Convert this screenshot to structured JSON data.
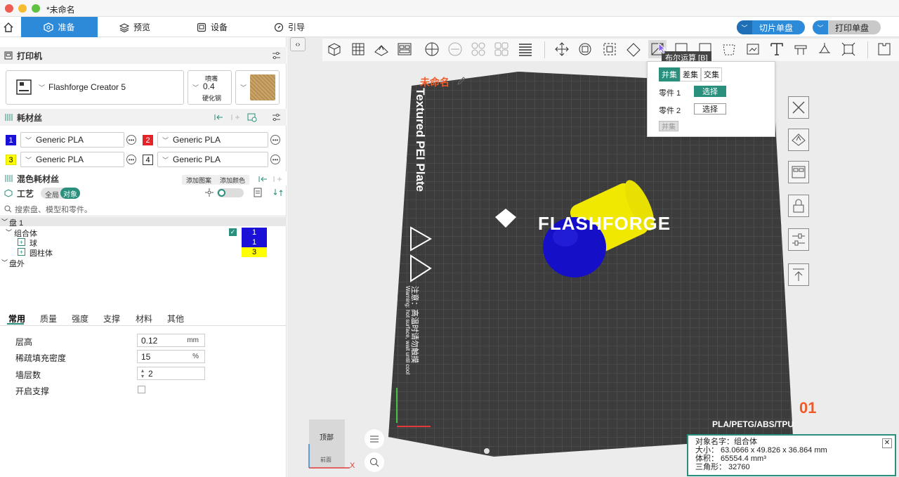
{
  "window": {
    "title": "*未命名"
  },
  "nav": {
    "home_label": "",
    "tabs": [
      {
        "label": "准备"
      },
      {
        "label": "预览"
      },
      {
        "label": "设备"
      },
      {
        "label": "引导"
      }
    ],
    "slice_button": "切片单盘",
    "print_button": "打印单盘"
  },
  "printer": {
    "section_title": "打印机",
    "name": "Flashforge Creator 5",
    "nozzle_label": "喷嘴",
    "nozzle_value": "0.4",
    "nozzle_type": "硬化钢"
  },
  "filament": {
    "section_title": "耗材丝",
    "slots": [
      {
        "num": "1",
        "name": "Generic PLA",
        "color": "#1a10d8"
      },
      {
        "num": "2",
        "name": "Generic PLA",
        "color": "#e5242a"
      },
      {
        "num": "3",
        "name": "Generic PLA",
        "color": "#ffff00"
      },
      {
        "num": "4",
        "name": "Generic PLA",
        "color": "#ffffff"
      }
    ]
  },
  "mixed": {
    "section_title": "混色耗材丝",
    "add_pattern": "添加图案",
    "add_color": "添加颜色"
  },
  "process": {
    "section_title": "工艺",
    "global_label": "全局",
    "object_label": "对象"
  },
  "search": {
    "placeholder": "搜索盘、模型和零件。"
  },
  "tree": {
    "plate": "盘 1",
    "group": "组合体",
    "group_num": "1",
    "parts": [
      {
        "name": "球",
        "num": "1"
      },
      {
        "name": "圆柱体",
        "num": "3"
      }
    ],
    "outside": "盘外"
  },
  "settings_tabs": [
    "常用",
    "质量",
    "强度",
    "支撑",
    "材料",
    "其他"
  ],
  "settings": {
    "layer_height_label": "层高",
    "layer_height": "0.12",
    "layer_height_unit": "mm",
    "infill_label": "稀疏填充密度",
    "infill": "15",
    "infill_unit": "%",
    "walls_label": "墙层数",
    "walls": "2",
    "support_label": "开启支撑"
  },
  "viewport": {
    "plate_name": "未命名",
    "plate_text": "Textured PEI Plate",
    "brand": "FLASHFORGE",
    "warning_cn": "注意：高温时请勿触摸",
    "warning_en": "Warning: hot surface, wait until cool",
    "materials": "PLA/PETG/ABS/TPU",
    "plate_number": "01",
    "view_cube_top": "顶部",
    "view_cube_front": "前面",
    "axis_x": "X"
  },
  "boolean": {
    "tooltip": "布尔运算 [B]",
    "tabs": [
      "并集",
      "差集",
      "交集"
    ],
    "part1_label": "零件 1",
    "part2_label": "零件 2",
    "select_label": "选择",
    "apply_label": "并集"
  },
  "info": {
    "name_line": "对象名字：组合体",
    "size_line": "大小：  63.0666 x 49.826 x 36.864 mm",
    "volume_line": "体积：  65554.4 mm³",
    "tri_line": "三角形：  32760"
  },
  "colors": {
    "accent": "#2a8f7c",
    "blue": "#2d8ad8",
    "brand_orange": "#f05a28"
  }
}
